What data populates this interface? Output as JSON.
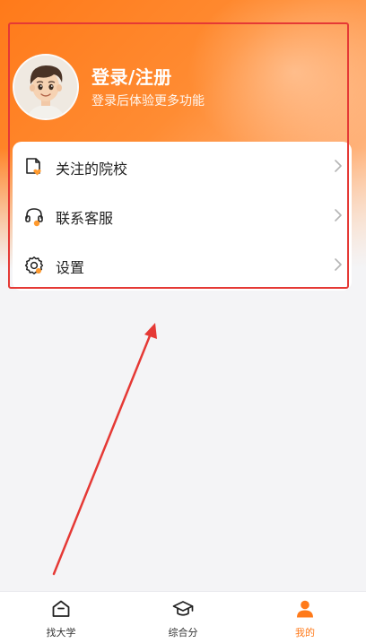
{
  "header": {
    "login_title": "登录/注册",
    "login_subtitle": "登录后体验更多功能",
    "avatar_icon": "user-avatar-icon"
  },
  "menu": {
    "items": [
      {
        "label": "关注的院校",
        "icon": "school-heart-icon"
      },
      {
        "label": "联系客服",
        "icon": "headset-icon"
      },
      {
        "label": "设置",
        "icon": "gear-icon"
      }
    ]
  },
  "tabbar": {
    "tabs": [
      {
        "label": "找大学",
        "icon": "house-icon",
        "active": false
      },
      {
        "label": "综合分",
        "icon": "graduation-cap-icon",
        "active": false
      },
      {
        "label": "我的",
        "icon": "person-icon",
        "active": true
      }
    ]
  },
  "colors": {
    "accent": "#ff7a1a",
    "annotation": "#e53935"
  }
}
